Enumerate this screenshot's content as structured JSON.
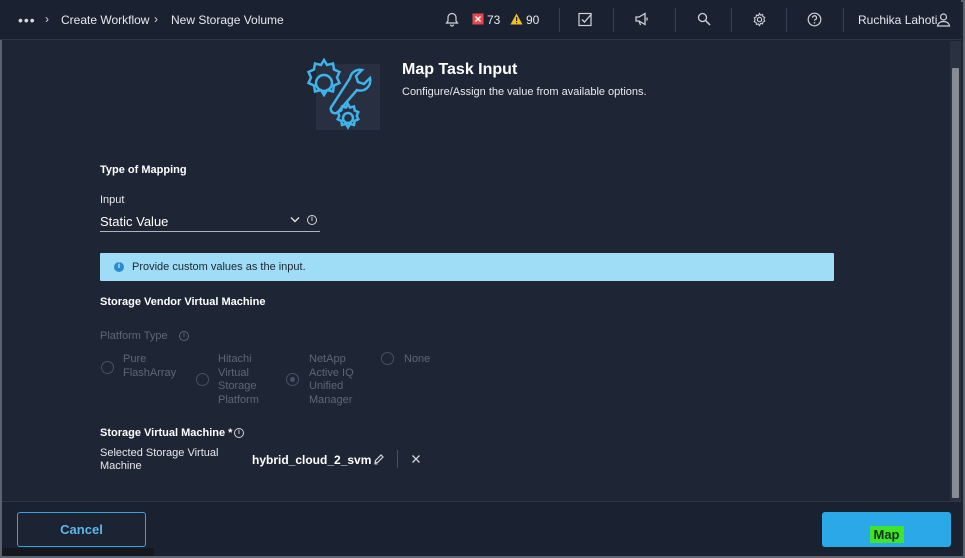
{
  "nav": {
    "breadcrumbs": [
      "Create Workflow",
      "New Storage Volume"
    ],
    "alerts_critical": "73",
    "alerts_warning": "90",
    "user_name": "Ruchika Lahoti"
  },
  "header": {
    "title": "Map Task Input",
    "subtitle": "Configure/Assign the value from available options."
  },
  "mapping": {
    "section_title": "Type of Mapping",
    "input_label": "Input",
    "input_value": "Static Value"
  },
  "banner": {
    "text": "Provide custom values as the input."
  },
  "vendor": {
    "section_title": "Storage Vendor Virtual Machine",
    "platform_label": "Platform Type",
    "options": [
      {
        "label_lines": [
          "Pure",
          "FlashArray"
        ],
        "selected": false
      },
      {
        "label_lines": [
          "Hitachi",
          "Virtual",
          "Storage",
          "Platform"
        ],
        "selected": false
      },
      {
        "label_lines": [
          "NetApp",
          "Active IQ",
          "Unified",
          "Manager"
        ],
        "selected": true
      },
      {
        "label_lines": [
          "None"
        ],
        "selected": false
      }
    ]
  },
  "svm": {
    "section_title": "Storage Virtual Machine *",
    "selected_label_line1": "Selected Storage Virtual",
    "selected_label_line2": "Machine",
    "selected_value": "hybrid_cloud_2_svm"
  },
  "footer": {
    "cancel_label": "Cancel",
    "map_label": "Map"
  },
  "colors": {
    "background": "#1e2534",
    "banner": "#9fdcf5",
    "primary": "#2aa8e8",
    "highlight": "#3fe52a",
    "critical": "#e5484d",
    "warning": "#f2c01b"
  },
  "icons": [
    "more-icon",
    "bell-icon",
    "critical-alert-icon",
    "warning-alert-icon",
    "tasks-icon",
    "megaphone-icon",
    "search-icon",
    "gear-icon",
    "help-icon",
    "user-icon",
    "settings-wrench-icon",
    "info-icon",
    "edit-icon",
    "close-icon",
    "chevron-down-icon"
  ]
}
